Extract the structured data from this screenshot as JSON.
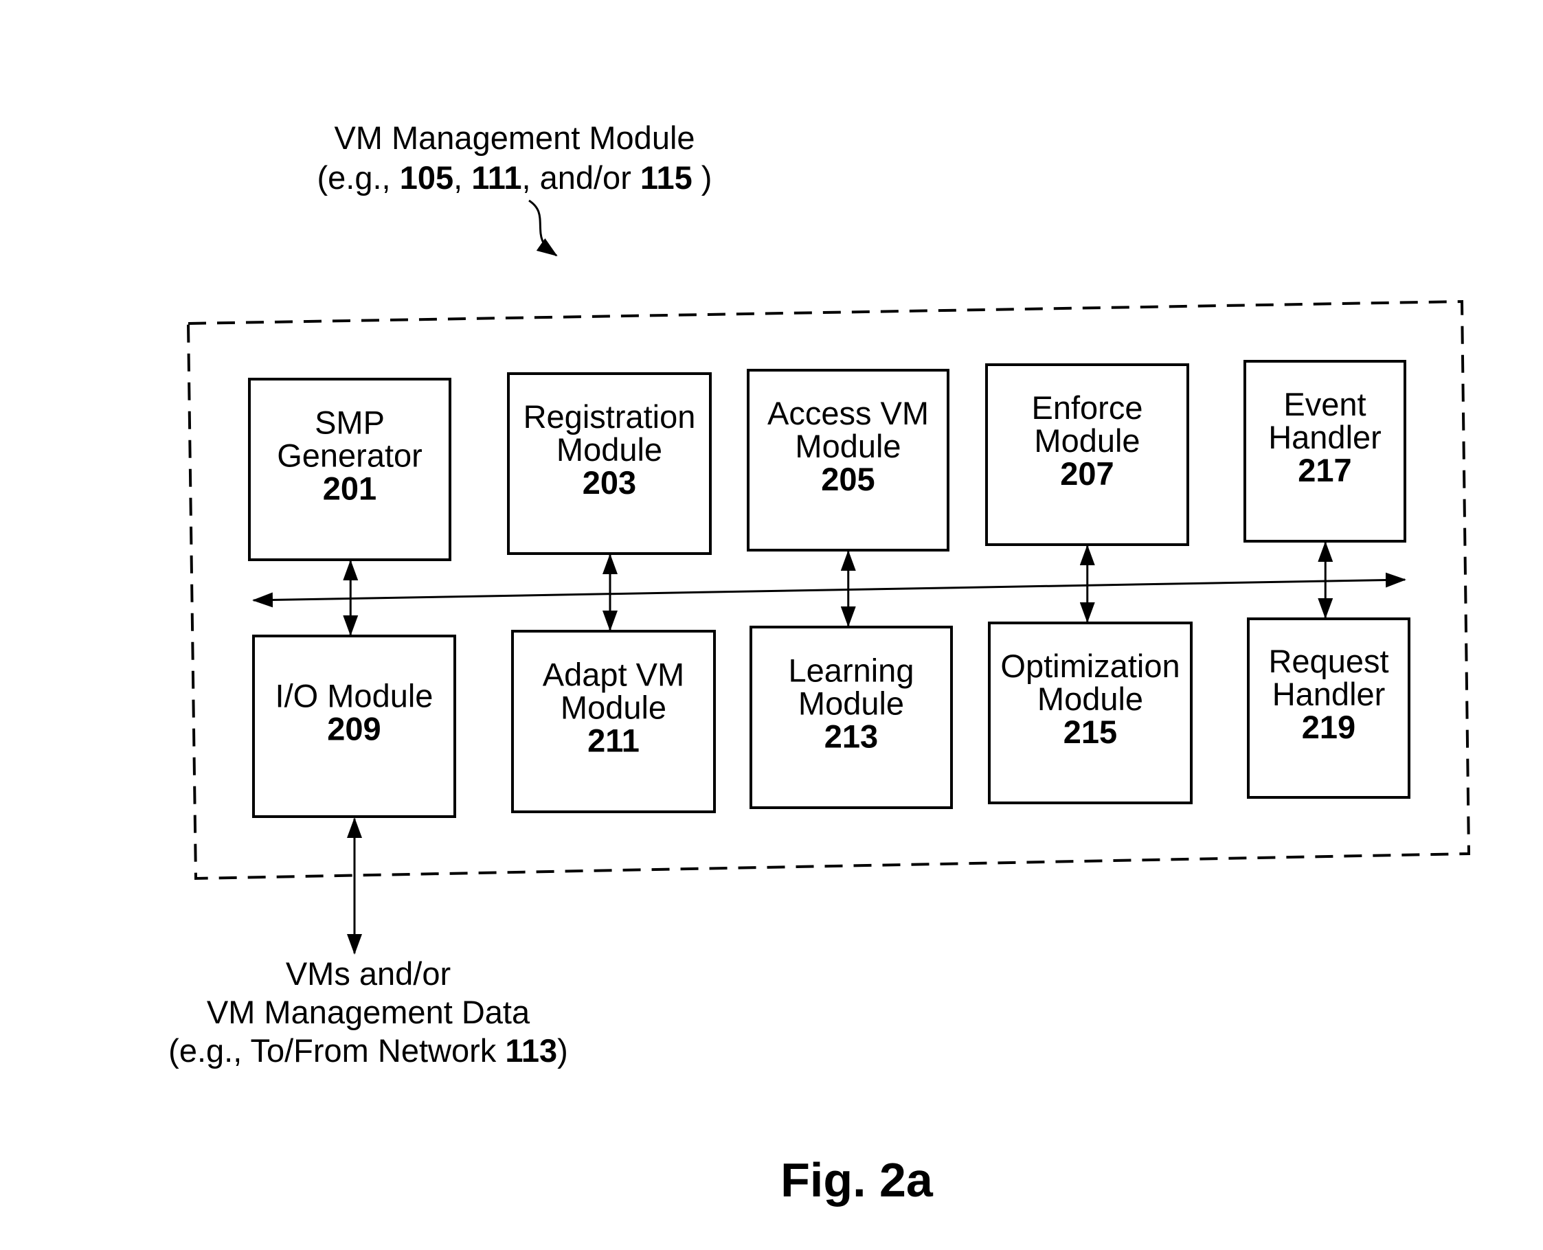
{
  "title": {
    "line1": "VM Management Module",
    "line2_prefix": "(e.g., ",
    "ref1": "105",
    "sep1": ", ",
    "ref2": "111",
    "sep2": ", and/or ",
    "ref3": "115",
    "line2_suffix": " )"
  },
  "top_modules": [
    {
      "lines": [
        "SMP",
        "Generator"
      ],
      "ref": "201"
    },
    {
      "lines": [
        "Registration",
        "Module"
      ],
      "ref": "203"
    },
    {
      "lines": [
        "Access VM",
        "Module"
      ],
      "ref": "205"
    },
    {
      "lines": [
        "Enforce",
        "Module"
      ],
      "ref": "207"
    },
    {
      "lines": [
        "Event",
        "Handler"
      ],
      "ref": "217"
    }
  ],
  "bottom_modules": [
    {
      "lines": [
        "I/O Module"
      ],
      "ref": "209"
    },
    {
      "lines": [
        "Adapt VM",
        "Module"
      ],
      "ref": "211"
    },
    {
      "lines": [
        "Learning",
        "Module"
      ],
      "ref": "213"
    },
    {
      "lines": [
        "Optimization",
        "Module"
      ],
      "ref": "215"
    },
    {
      "lines": [
        "Request",
        "Handler"
      ],
      "ref": "219"
    }
  ],
  "external": {
    "line1": "VMs and/or",
    "line2": "VM Management Data",
    "line3_prefix": "(e.g., To/From Network ",
    "ref": "113",
    "line3_suffix": ")"
  },
  "figure_label": "Fig. 2a"
}
